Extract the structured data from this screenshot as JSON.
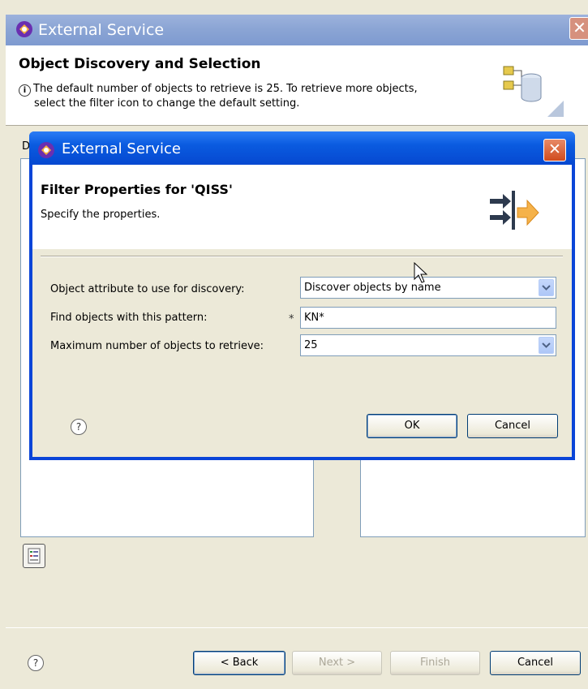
{
  "outer_window": {
    "title": "External Service",
    "header_title": "Object Discovery and Selection",
    "info_line1": "The default number of objects to retrieve is 25.  To retrieve more objects,",
    "info_line2": "select the filter icon to change the default setting.",
    "partial_label": "D",
    "icons": [
      "app-icon",
      "close-icon",
      "info-icon",
      "database-icon",
      "filter-icon",
      "help-icon"
    ],
    "buttons": {
      "back": "< Back",
      "next": "Next >",
      "finish": "Finish",
      "cancel": "Cancel"
    }
  },
  "dialog": {
    "title": "External Service",
    "header_title": "Filter Properties for 'QISS'",
    "header_desc": "Specify the properties.",
    "icons": [
      "app-icon",
      "close-icon",
      "import-arrows-icon",
      "help-icon",
      "chevron-down-icon"
    ],
    "fields": {
      "attribute_label": "Object attribute to use for discovery:",
      "attribute_value": "Discover objects by name",
      "pattern_label": "Find objects with this pattern:",
      "pattern_required": "*",
      "pattern_value": "KN*",
      "max_label": "Maximum number of objects to retrieve:",
      "max_value": "25"
    },
    "buttons": {
      "ok": "OK",
      "cancel": "Cancel"
    }
  },
  "colors": {
    "dialog_title_blue": "#0a5be0",
    "inactive_title_blue": "#8aa4d4",
    "close_red": "#d04b1d",
    "window_bg": "#ece9d8"
  }
}
